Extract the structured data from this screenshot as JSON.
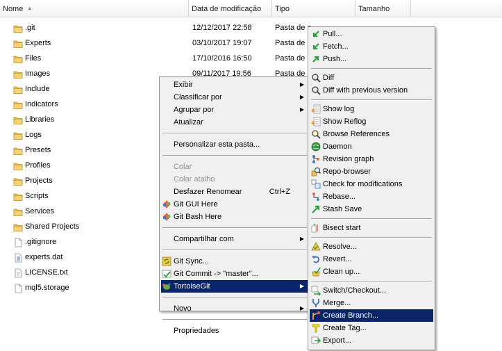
{
  "header": {
    "columns": [
      "Nome",
      "Data de modificação",
      "Tipo",
      "Tamanho"
    ],
    "sort_arrow": "▲"
  },
  "files": [
    {
      "name": ".git",
      "date": "12/12/2017 22:58",
      "type": "Pasta de a",
      "icon": "folder-icon"
    },
    {
      "name": "Experts",
      "date": "03/10/2017 19:07",
      "type": "Pasta de a",
      "icon": "folder-icon"
    },
    {
      "name": "Files",
      "date": "17/10/2016 16:50",
      "type": "Pasta de a",
      "icon": "folder-icon"
    },
    {
      "name": "Images",
      "date": "09/11/2017 19:56",
      "type": "Pasta de a",
      "icon": "folder-icon"
    },
    {
      "name": "Include",
      "date": "",
      "type": "",
      "icon": "folder-icon"
    },
    {
      "name": "Indicators",
      "date": "",
      "type": "",
      "icon": "folder-icon"
    },
    {
      "name": "Libraries",
      "date": "",
      "type": "",
      "icon": "folder-icon"
    },
    {
      "name": "Logs",
      "date": "",
      "type": "",
      "icon": "folder-icon"
    },
    {
      "name": "Presets",
      "date": "",
      "type": "",
      "icon": "folder-icon"
    },
    {
      "name": "Profiles",
      "date": "",
      "type": "",
      "icon": "folder-icon"
    },
    {
      "name": "Projects",
      "date": "",
      "type": "",
      "icon": "folder-icon"
    },
    {
      "name": "Scripts",
      "date": "",
      "type": "",
      "icon": "folder-icon"
    },
    {
      "name": "Services",
      "date": "",
      "type": "",
      "icon": "folder-icon"
    },
    {
      "name": "Shared Projects",
      "date": "",
      "type": "",
      "icon": "folder-icon"
    },
    {
      "name": ".gitignore",
      "date": "",
      "type": "",
      "icon": "file-icon"
    },
    {
      "name": "experts.dat",
      "date": "",
      "type": "",
      "icon": "data-file-icon"
    },
    {
      "name": "LICENSE.txt",
      "date": "",
      "type": "",
      "icon": "text-file-icon"
    },
    {
      "name": "mql5.storage",
      "date": "",
      "type": "",
      "icon": "file-icon"
    }
  ],
  "context_menu": {
    "items": [
      {
        "label": "Exibir",
        "submenu": true
      },
      {
        "label": "Classificar por",
        "submenu": true
      },
      {
        "label": "Agrupar por",
        "submenu": true
      },
      {
        "label": "Atualizar"
      },
      {
        "separator": true
      },
      {
        "label": "Personalizar esta pasta..."
      },
      {
        "separator": true
      },
      {
        "label": "Colar",
        "disabled": true
      },
      {
        "label": "Colar atalho",
        "disabled": true
      },
      {
        "label": "Desfazer Renomear",
        "shortcut": "Ctrl+Z"
      },
      {
        "label": "Git GUI Here",
        "icon": "git-gui-icon"
      },
      {
        "label": "Git Bash Here",
        "icon": "git-bash-icon"
      },
      {
        "separator": true
      },
      {
        "label": "Compartilhar com",
        "submenu": true
      },
      {
        "separator": true
      },
      {
        "label": "Git Sync...",
        "icon": "git-sync-icon"
      },
      {
        "label": "Git Commit -> \"master\"...",
        "icon": "git-commit-icon"
      },
      {
        "label": "TortoiseGit",
        "submenu": true,
        "selected": true,
        "icon": "tortoisegit-icon"
      },
      {
        "separator": true
      },
      {
        "label": "Novo",
        "submenu": true
      },
      {
        "separator": true
      },
      {
        "label": "Propriedades"
      }
    ]
  },
  "tortoisegit_menu": {
    "items": [
      {
        "label": "Pull...",
        "icon": "pull-icon"
      },
      {
        "label": "Fetch...",
        "icon": "fetch-icon"
      },
      {
        "label": "Push...",
        "icon": "push-icon"
      },
      {
        "separator": true
      },
      {
        "label": "Diff",
        "icon": "diff-icon"
      },
      {
        "label": "Diff with previous version",
        "icon": "diff-previous-icon"
      },
      {
        "separator": true
      },
      {
        "label": "Show log",
        "icon": "show-log-icon"
      },
      {
        "label": "Show Reflog",
        "icon": "reflog-icon"
      },
      {
        "label": "Browse References",
        "icon": "browse-references-icon"
      },
      {
        "label": "Daemon",
        "icon": "daemon-icon"
      },
      {
        "label": "Revision graph",
        "icon": "revision-graph-icon"
      },
      {
        "label": "Repo-browser",
        "icon": "repo-browser-icon"
      },
      {
        "label": "Check for modifications",
        "icon": "check-modifications-icon"
      },
      {
        "label": "Rebase...",
        "icon": "rebase-icon"
      },
      {
        "label": "Stash Save",
        "icon": "stash-save-icon"
      },
      {
        "separator": true
      },
      {
        "label": "Bisect start",
        "icon": "bisect-icon"
      },
      {
        "separator": true
      },
      {
        "label": "Resolve...",
        "icon": "resolve-icon"
      },
      {
        "label": "Revert...",
        "icon": "revert-icon"
      },
      {
        "label": "Clean up...",
        "icon": "cleanup-icon"
      },
      {
        "separator": true
      },
      {
        "label": "Switch/Checkout...",
        "icon": "switch-checkout-icon"
      },
      {
        "label": "Merge...",
        "icon": "merge-icon"
      },
      {
        "label": "Create Branch...",
        "icon": "create-branch-icon",
        "selected": true
      },
      {
        "label": "Create Tag...",
        "icon": "create-tag-icon"
      },
      {
        "label": "Export...",
        "icon": "export-icon"
      }
    ]
  },
  "colors": {
    "selection": "#0a246a",
    "menu_bg": "#f0f0f0",
    "folder": "#e8c15a",
    "disabled_text": "#8d8d8d"
  }
}
